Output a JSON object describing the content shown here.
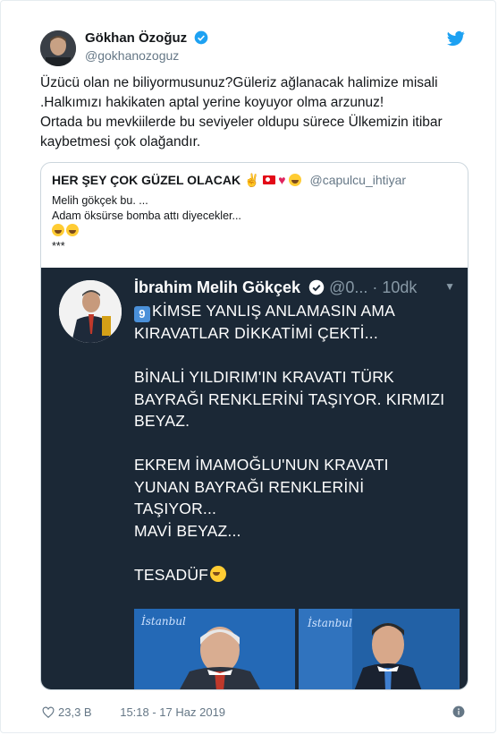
{
  "tweet": {
    "author_name": "Gökhan Özoğuz",
    "author_handle": "@gokhanozoguz",
    "text_lines": [
      "Üzücü olan ne biliyormusunuz?Güleriz ağlanacak halimize misali",
      ".Halkımızı hakikaten aptal yerine koyuyor olma arzunuz!",
      "Ortada bu mevkiilerde bu seviyeler oldupu sürece Ülkemizin itibar",
      "kaybetmesi çok olağandır."
    ]
  },
  "quote": {
    "author_name": "HER ŞEY ÇOK GÜZEL OLACAK",
    "author_handle": "@capulcu_ihtiyar",
    "text_lines": [
      "Melih gökçek bu. ...",
      "Adam öksürse bomba attı diyecekler...",
      "",
      "***"
    ]
  },
  "screenshot": {
    "author_name": "İbrahim Melih Gökçek",
    "handle_time": "@0... · 10dk",
    "lines": [
      "KİMSE YANLIŞ ANLAMASIN AMA",
      "KIRAVATLAR DİKKATİMİ ÇEKTİ...",
      "",
      "BİNALİ YILDIRIM'IN KRAVATI TÜRK",
      "BAYRAĞI RENKLERİNİ TAŞIYOR. KIRMIZI",
      "BEYAZ.",
      "",
      "EKREM İMAMOĞLU'NUN KRAVATI",
      "YUNAN BAYRAĞI RENKLERİNİ",
      "TAŞIYOR...",
      "MAVİ BEYAZ...",
      "",
      "TESADÜF"
    ],
    "photo_watermark_1": "İstanbul",
    "photo_watermark_2": "İstanbul"
  },
  "footer": {
    "likes": "23,3 B",
    "timestamp": "15:18 - 17 Haz 2019"
  },
  "colors": {
    "link_blue": "#1da1f2",
    "heart_red": "#e0245e",
    "dark_bg": "#1b2836"
  },
  "icons": [
    "verified-icon",
    "twitter-bird-icon",
    "heart-icon",
    "info-icon",
    "chevron-down-icon"
  ]
}
